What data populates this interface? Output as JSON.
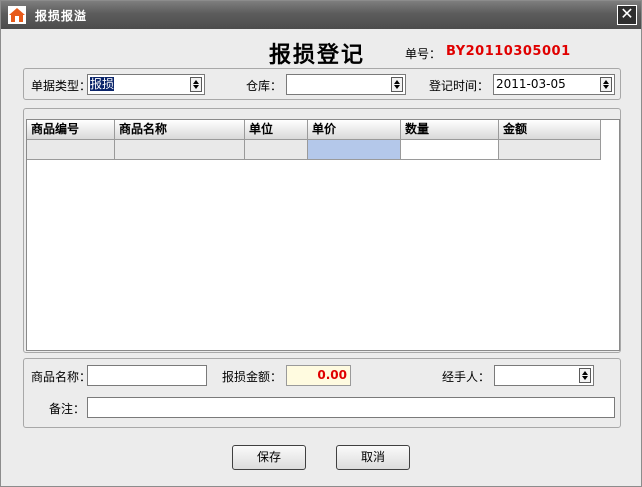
{
  "window": {
    "title": "报损报溢",
    "close_glyph": "✕"
  },
  "heading": "报损登记",
  "doc_no": {
    "label": "单号：",
    "value": "BY20110305001"
  },
  "top": {
    "doc_type_label": "单据类型：",
    "doc_type_value": "报损",
    "warehouse_label": "仓库：",
    "warehouse_value": "",
    "date_label": "登记时间：",
    "date_value": "2011-03-05"
  },
  "grid": {
    "columns": [
      "商品编号",
      "商品名称",
      "单位",
      "单价",
      "数量",
      "金额"
    ],
    "rows": [
      [
        "",
        "",
        "",
        "",
        "",
        ""
      ]
    ]
  },
  "bottom": {
    "product_label": "商品名称：",
    "product_value": "",
    "amount_label": "报损金额：",
    "amount_value": "0.00",
    "handler_label": "经手人：",
    "handler_value": "",
    "note_label": "备注：",
    "note_value": ""
  },
  "buttons": {
    "save": "保存",
    "cancel": "取消"
  },
  "colors": {
    "doc_no": "#e00000",
    "amount": "#e00000",
    "active_cell": "#b4c8ea"
  },
  "icons": {
    "title": "home-icon",
    "close": "close-icon",
    "spinner": "spinner-icon"
  }
}
